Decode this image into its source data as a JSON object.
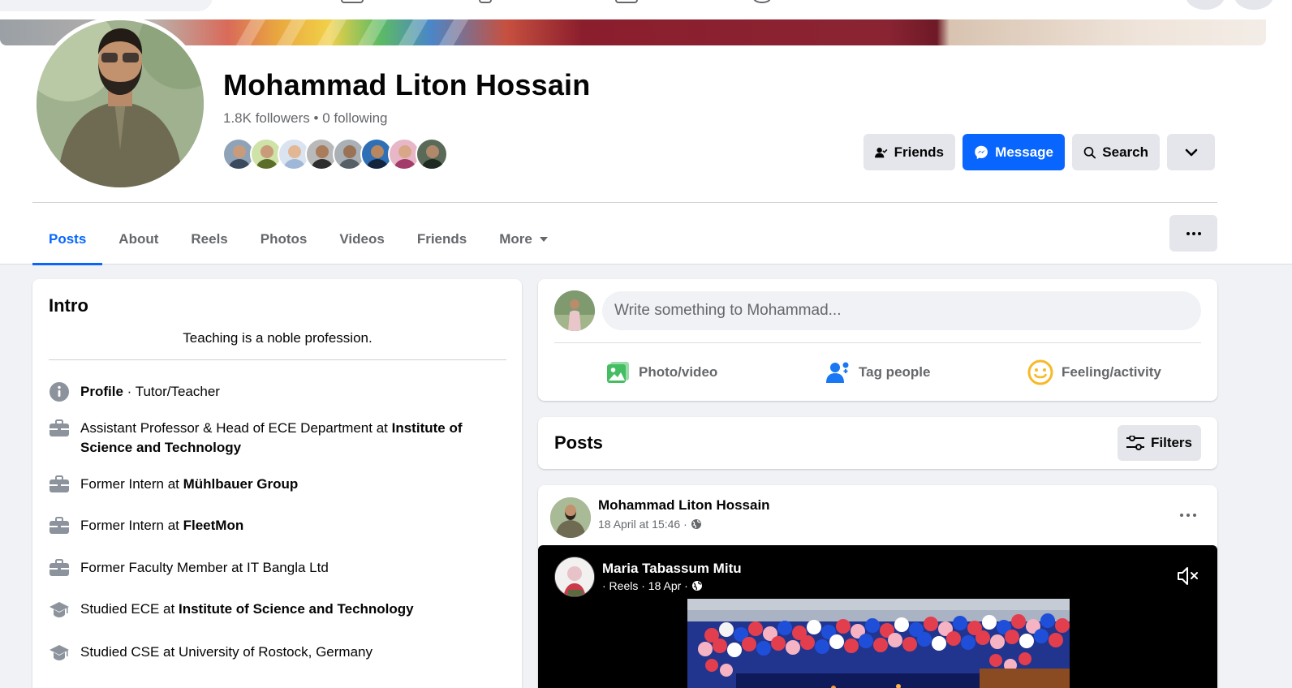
{
  "profile": {
    "name": "Mohammad Liton Hossain",
    "followers": "1.8K followers",
    "separator": " • ",
    "following": "0 following"
  },
  "actions": {
    "friends_label": "Friends",
    "message_label": "Message",
    "search_label": "Search"
  },
  "tabs": [
    {
      "label": "Posts",
      "active": true
    },
    {
      "label": "About"
    },
    {
      "label": "Reels"
    },
    {
      "label": "Photos"
    },
    {
      "label": "Videos"
    },
    {
      "label": "Friends"
    },
    {
      "label": "More"
    }
  ],
  "intro": {
    "title": "Intro",
    "bio": "Teaching is a noble profession.",
    "items": [
      {
        "icon": "info-icon",
        "bold_lead": "Profile",
        "text": " · Tutor/Teacher"
      },
      {
        "icon": "briefcase-icon",
        "text": "Assistant Professor & Head of ECE Department at ",
        "bold": "Institute of Science and Technology"
      },
      {
        "icon": "briefcase-icon",
        "text": "Former Intern at ",
        "bold": "Mühlbauer Group"
      },
      {
        "icon": "briefcase-icon",
        "text": "Former Intern at ",
        "bold": "FleetMon"
      },
      {
        "icon": "briefcase-icon",
        "text": "Former Faculty Member at IT Bangla Ltd"
      },
      {
        "icon": "graduation-cap-icon",
        "text": "Studied ECE at ",
        "bold": "Institute of Science and Technology"
      },
      {
        "icon": "graduation-cap-icon",
        "text": "Studied CSE at University of Rostock, Germany"
      }
    ]
  },
  "composer": {
    "placeholder": "Write something to Mohammad...",
    "photo_video": "Photo/video",
    "tag_people": "Tag people",
    "feeling_activity": "Feeling/activity"
  },
  "posts_section": {
    "title": "Posts",
    "filters_label": "Filters"
  },
  "post": {
    "author": "Mohammad Liton Hossain",
    "time": "18 April at 15:46 ·",
    "shared": {
      "author": "Maria Tabassum Mitu",
      "meta": "· Reels · 18 Apr ·"
    }
  },
  "colors": {
    "accent": "#0866ff",
    "page_bg": "#f0f2f5",
    "secondary_text": "#65676b",
    "button_grey": "#e4e6eb",
    "photo_green": "#45bd62",
    "tag_blue": "#1877f2",
    "feeling_yellow": "#f7b928"
  }
}
